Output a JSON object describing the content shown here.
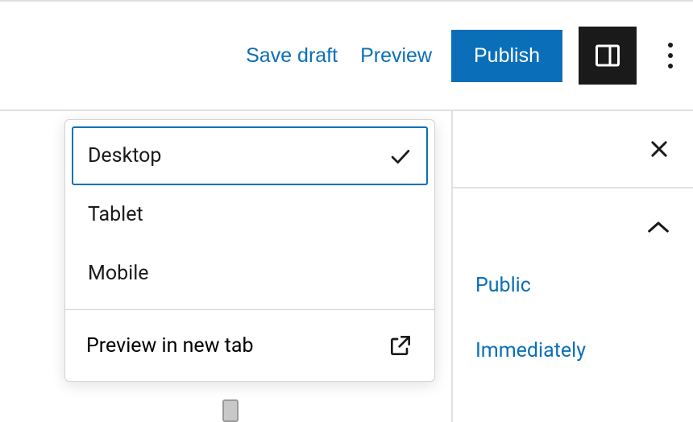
{
  "toolbar": {
    "save_draft_label": "Save draft",
    "preview_label": "Preview",
    "publish_label": "Publish"
  },
  "preview_menu": {
    "options": [
      {
        "label": "Desktop",
        "selected": true
      },
      {
        "label": "Tablet",
        "selected": false
      },
      {
        "label": "Mobile",
        "selected": false
      }
    ],
    "new_tab_label": "Preview in new tab"
  },
  "sidebar": {
    "visibility_value": "Public",
    "publish_time_value": "Immediately"
  },
  "icons": {
    "sidebar_toggle": "sidebar-icon",
    "more": "more-vertical-icon",
    "close": "close-icon",
    "chevron_up": "chevron-up-icon",
    "check": "check-icon",
    "external": "external-link-icon"
  }
}
